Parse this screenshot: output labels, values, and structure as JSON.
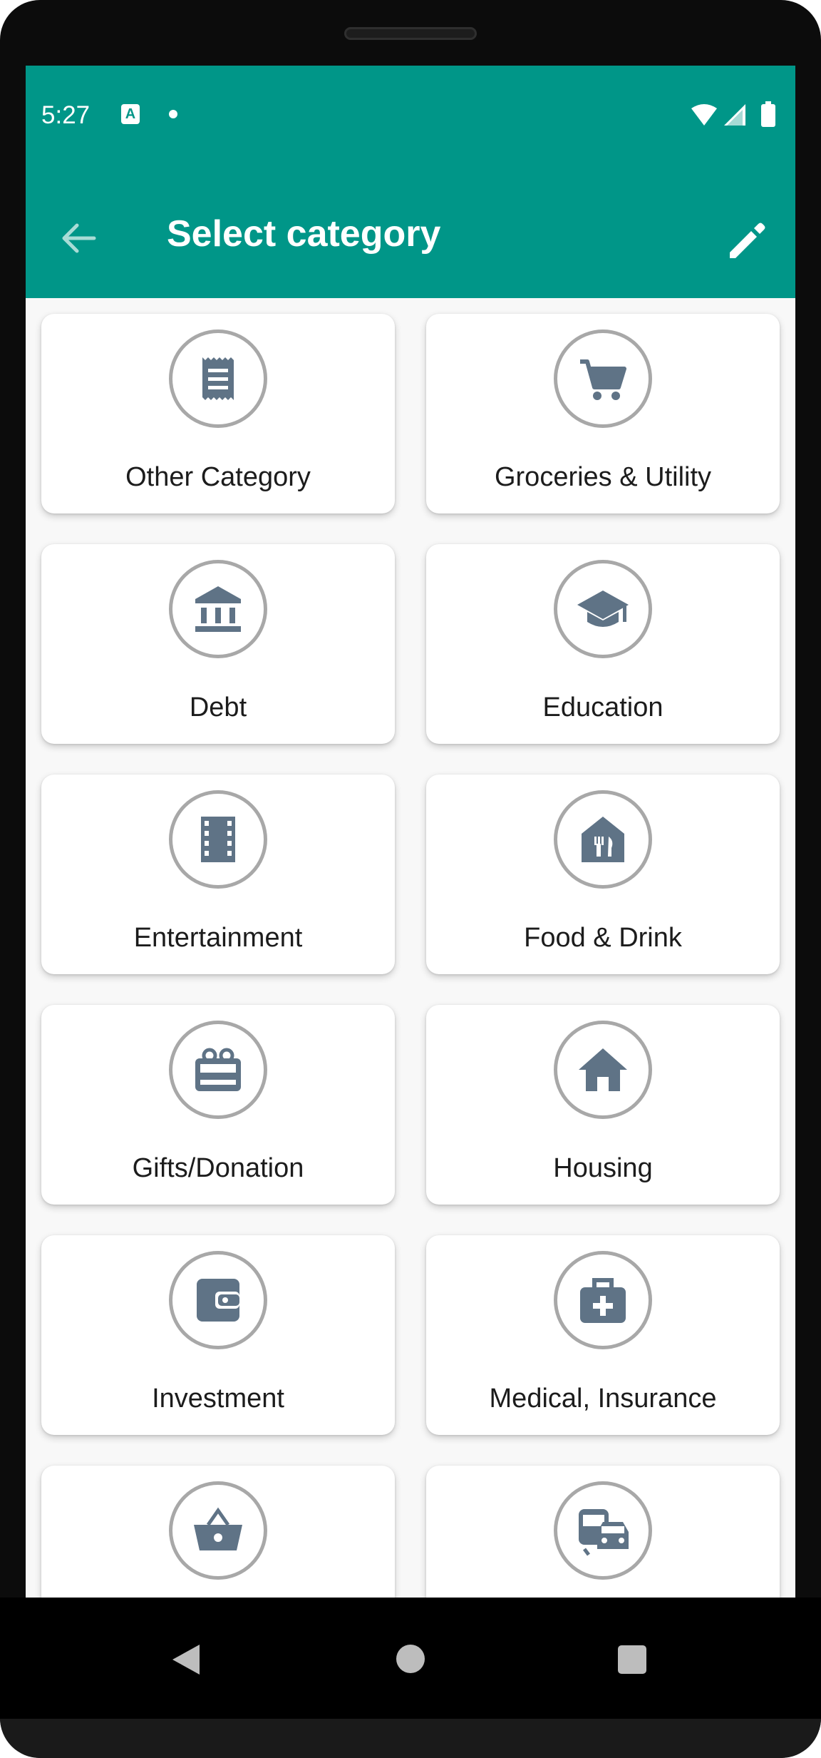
{
  "status_bar": {
    "time": "5:27",
    "notification_icon": "A"
  },
  "app_bar": {
    "title": "Select category",
    "back_icon": "arrow-back-icon",
    "edit_icon": "pencil-icon",
    "color": "#009688"
  },
  "categories": [
    {
      "label": "Other Category",
      "icon": "receipt-icon"
    },
    {
      "label": "Groceries & Utility",
      "icon": "shopping-cart-icon"
    },
    {
      "label": "Debt",
      "icon": "bank-icon"
    },
    {
      "label": "Education",
      "icon": "graduation-cap-icon"
    },
    {
      "label": "Entertainment",
      "icon": "film-icon"
    },
    {
      "label": "Food & Drink",
      "icon": "restaurant-icon"
    },
    {
      "label": "Gifts/Donation",
      "icon": "gift-card-icon"
    },
    {
      "label": "Housing",
      "icon": "home-icon"
    },
    {
      "label": "Investment",
      "icon": "wallet-icon"
    },
    {
      "label": "Medical, Insurance",
      "icon": "medical-bag-icon"
    },
    {
      "label": "",
      "icon": "shopping-basket-icon"
    },
    {
      "label": "",
      "icon": "transport-icon"
    }
  ],
  "icon_color": "#5f7386",
  "system_nav": {
    "back_icon": "nav-back-icon",
    "home_icon": "nav-home-icon",
    "recents_icon": "nav-recents-icon"
  }
}
